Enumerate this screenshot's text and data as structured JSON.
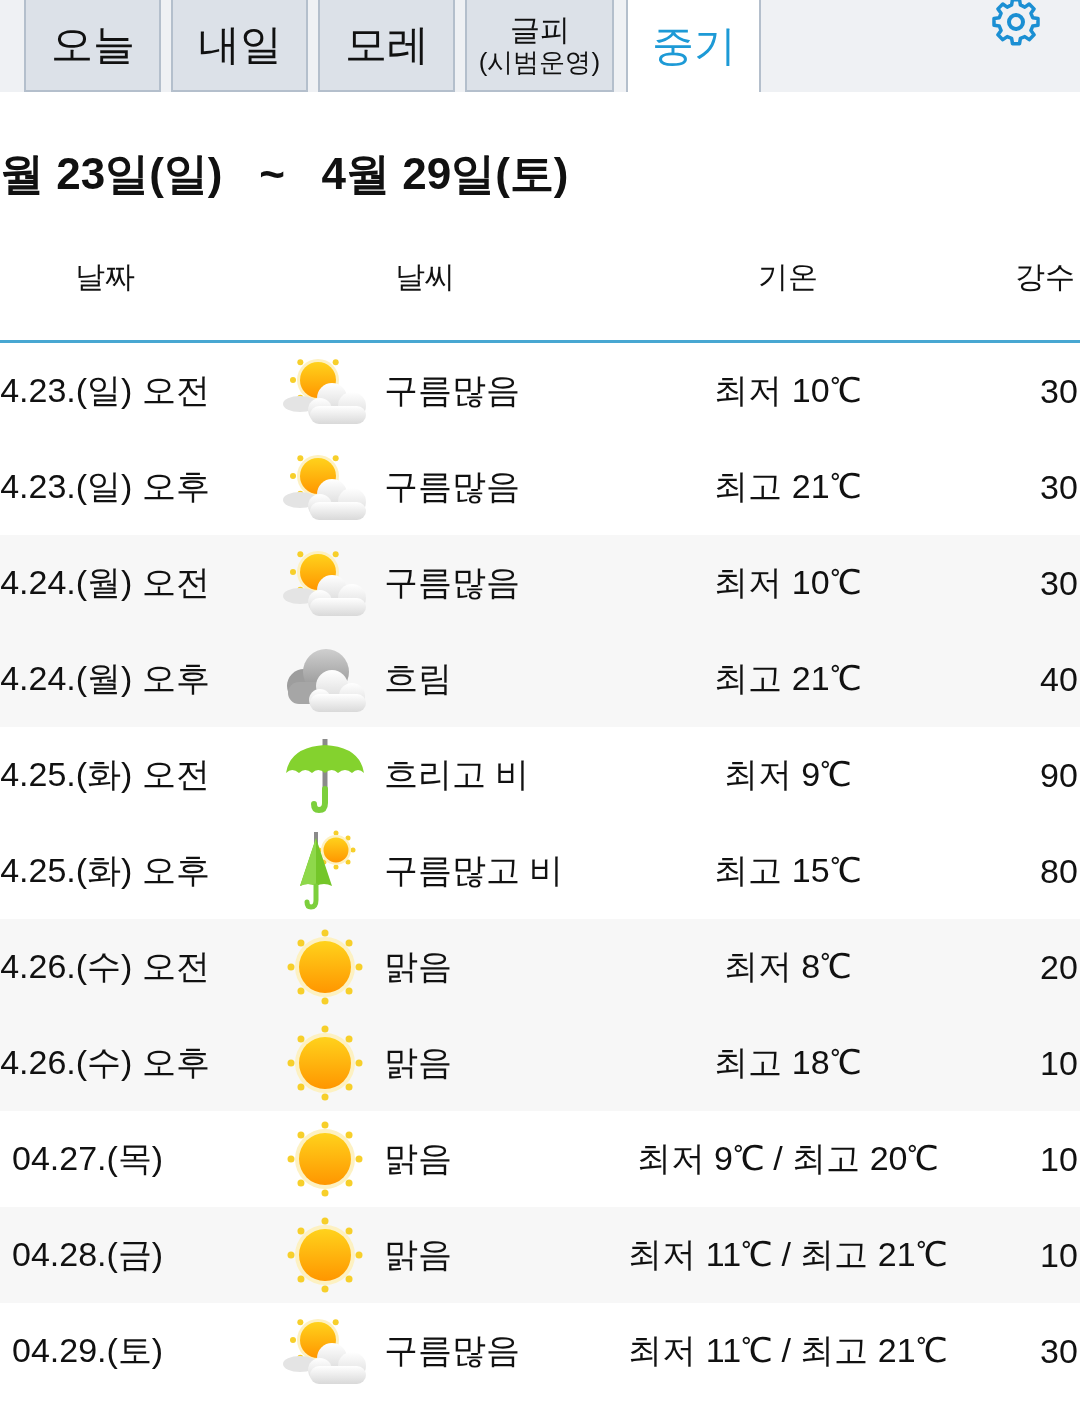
{
  "tabs": [
    {
      "label": "오늘",
      "selected": false
    },
    {
      "label": "내일",
      "selected": false
    },
    {
      "label": "모레",
      "selected": false
    },
    {
      "label": "글피",
      "sublabel": "(시범운영)",
      "selected": false
    },
    {
      "label": "중기",
      "selected": true
    }
  ],
  "period_title": "월 23일(일)   ~   4월 29일(토)",
  "table": {
    "columns": [
      "날짜",
      "날씨",
      "기온",
      "강수"
    ],
    "days": [
      {
        "periods": [
          {
            "date": "4.23.(일) 오전",
            "kind": "partly-cloudy",
            "weather": "구름많음",
            "temperature": "최저 10℃",
            "precipitation": "30"
          },
          {
            "date": "4.23.(일) 오후",
            "kind": "partly-cloudy",
            "weather": "구름많음",
            "temperature": "최고 21℃",
            "precipitation": "30"
          }
        ]
      },
      {
        "periods": [
          {
            "date": "4.24.(월) 오전",
            "kind": "partly-cloudy",
            "weather": "구름많음",
            "temperature": "최저 10℃",
            "precipitation": "30"
          },
          {
            "date": "4.24.(월) 오후",
            "kind": "cloudy",
            "weather": "흐림",
            "temperature": "최고 21℃",
            "precipitation": "40"
          }
        ]
      },
      {
        "periods": [
          {
            "date": "4.25.(화) 오전",
            "kind": "rain",
            "weather": "흐리고 비",
            "temperature": "최저 9℃",
            "precipitation": "90"
          },
          {
            "date": "4.25.(화) 오후",
            "kind": "sun-rain",
            "weather": "구름많고 비",
            "temperature": "최고 15℃",
            "precipitation": "80"
          }
        ]
      },
      {
        "periods": [
          {
            "date": "4.26.(수) 오전",
            "kind": "sunny",
            "weather": "맑음",
            "temperature": "최저 8℃",
            "precipitation": "20"
          },
          {
            "date": "4.26.(수) 오후",
            "kind": "sunny",
            "weather": "맑음",
            "temperature": "최고 18℃",
            "precipitation": "10"
          }
        ]
      },
      {
        "periods": [
          {
            "date": "04.27.(목)",
            "kind": "sunny",
            "weather": "맑음",
            "temperature": "최저 9℃ / 최고 20℃",
            "precipitation": "10"
          }
        ]
      },
      {
        "periods": [
          {
            "date": "04.28.(금)",
            "kind": "sunny",
            "weather": "맑음",
            "temperature": "최저 11℃ / 최고 21℃",
            "precipitation": "10"
          }
        ]
      },
      {
        "periods": [
          {
            "date": "04.29.(토)",
            "kind": "partly-cloudy",
            "weather": "구름많음",
            "temperature": "최저 11℃ / 최고 21℃",
            "precipitation": "30"
          }
        ]
      }
    ]
  }
}
